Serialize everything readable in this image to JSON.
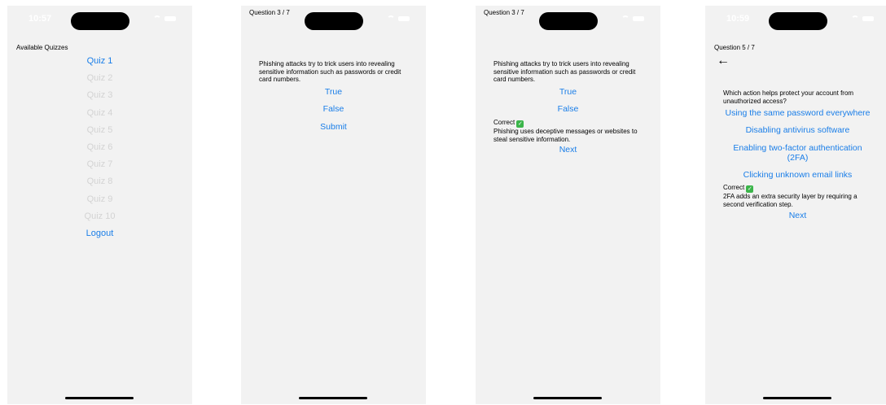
{
  "screen1": {
    "time": "10:57",
    "heading": "Available Quizzes",
    "quizzes": [
      {
        "label": "Quiz 1",
        "enabled": true
      },
      {
        "label": "Quiz 2",
        "enabled": false
      },
      {
        "label": "Quiz 3",
        "enabled": false
      },
      {
        "label": "Quiz 4",
        "enabled": false
      },
      {
        "label": "Quiz 5",
        "enabled": false
      },
      {
        "label": "Quiz 6",
        "enabled": false
      },
      {
        "label": "Quiz 7",
        "enabled": false
      },
      {
        "label": "Quiz 8",
        "enabled": false
      },
      {
        "label": "Quiz 9",
        "enabled": false
      },
      {
        "label": "Quiz 10",
        "enabled": false
      }
    ],
    "logout": "Logout"
  },
  "screen2": {
    "header": "Question 3 / 7",
    "question": "Phishing attacks try to trick users into revealing sensitive information such as passwords or credit card numbers.",
    "option_true": "True",
    "option_false": "False",
    "submit": "Submit"
  },
  "screen3": {
    "header": "Question 3 / 7",
    "question": "Phishing attacks try to trick users into revealing sensitive information such as passwords or credit card numbers.",
    "option_true": "True",
    "option_false": "False",
    "feedback_label": "Correct",
    "feedback_explanation": "Phishing uses deceptive messages or websites to steal sensitive information.",
    "next": "Next"
  },
  "screen4": {
    "time": "10:59",
    "header": "Question 5 / 7",
    "question": "Which action helps protect your account from unauthorized access?",
    "options": [
      "Using the same password everywhere",
      "Disabling antivirus software",
      "Enabling two-factor authentication (2FA)",
      "Clicking unknown email links"
    ],
    "feedback_label": "Correct",
    "feedback_explanation": "2FA adds an extra security layer by requiring a second verification step.",
    "next": "Next"
  },
  "colors": {
    "link": "#1a7ee8",
    "disabled": "#d3d3d3",
    "screen_bg": "#f2f2f2",
    "check": "#3bb54a"
  },
  "icons": [
    "back-arrow-icon",
    "check-mark-icon",
    "wifi-icon",
    "battery-icon"
  ]
}
